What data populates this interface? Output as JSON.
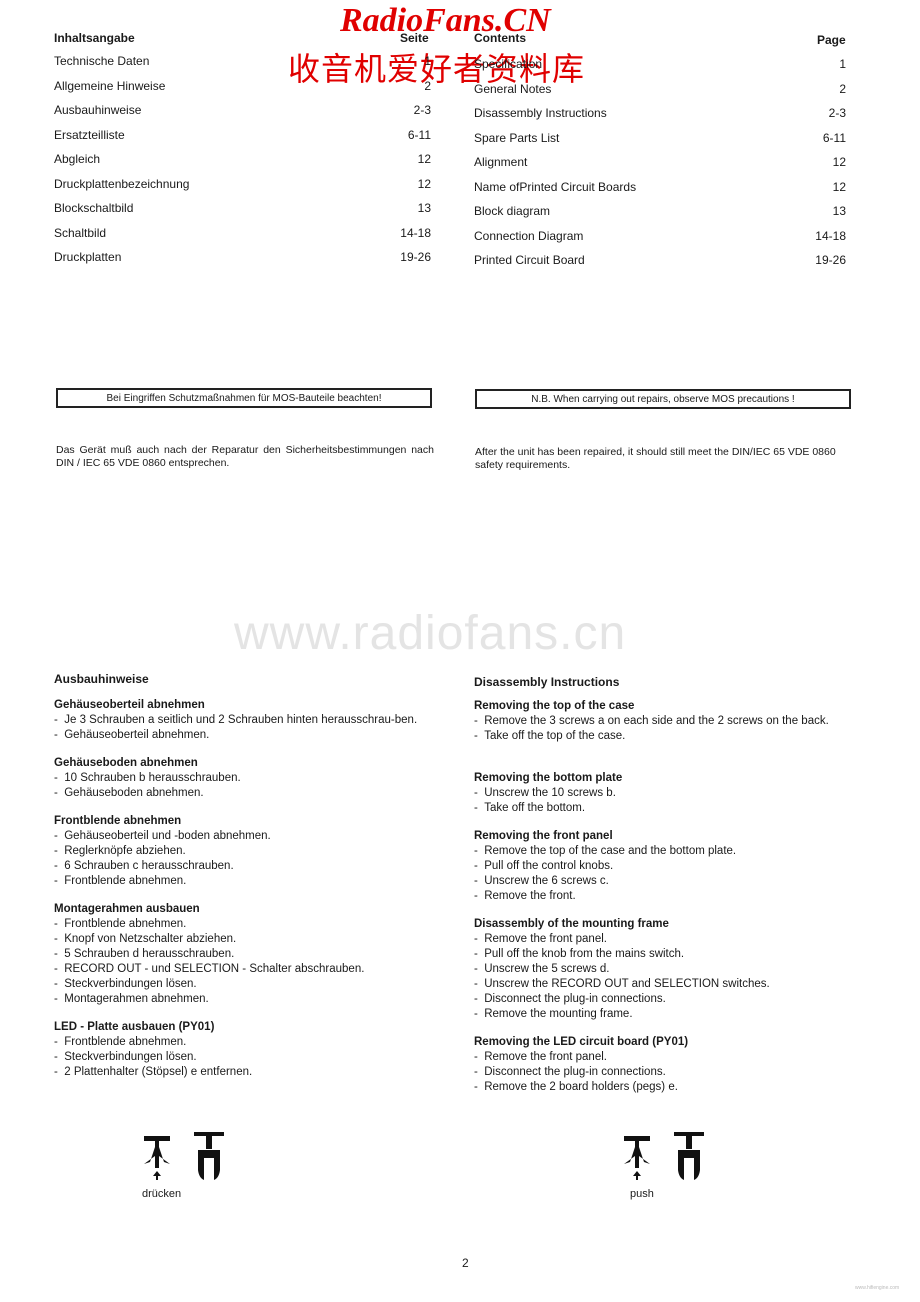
{
  "watermark": {
    "brand": "RadioFans.CN",
    "brand_cn": "收音机爱好者资料库",
    "url": "www.radiofans.cn",
    "color": "#e00000"
  },
  "toc_de": {
    "title": "Inhaltsangabe",
    "page_header": "Seite",
    "items": [
      {
        "label": "Technische Daten",
        "page": "1"
      },
      {
        "label": "Allgemeine Hinweise",
        "page": "2"
      },
      {
        "label": "Ausbauhinweise",
        "page": "2-3"
      },
      {
        "label": "Ersatzteilliste",
        "page": "6-11"
      },
      {
        "label": "Abgleich",
        "page": "12"
      },
      {
        "label": "Druckplattenbezeichnung",
        "page": "12"
      },
      {
        "label": "Blockschaltbild",
        "page": "13"
      },
      {
        "label": "Schaltbild",
        "page": "14-18"
      },
      {
        "label": "Druckplatten",
        "page": "19-26"
      }
    ]
  },
  "toc_en": {
    "title": "Contents",
    "page_header": "Page",
    "items": [
      {
        "label": "Specification",
        "page": "1"
      },
      {
        "label": "General Notes",
        "page": "2"
      },
      {
        "label": "Disassembly Instructions",
        "page": "2-3"
      },
      {
        "label": "Spare Parts List",
        "page": "6-11"
      },
      {
        "label": "Alignment",
        "page": "12"
      },
      {
        "label": "Name ofPrinted Circuit Boards",
        "page": "12"
      },
      {
        "label": "Block diagram",
        "page": "13"
      },
      {
        "label": "Connection Diagram",
        "page": "14-18"
      },
      {
        "label": "Printed Circuit Board",
        "page": "19-26"
      }
    ]
  },
  "notice_de": "Bei Eingriffen Schutzmaßnahmen für MOS-Bauteile beachten!",
  "notice_en": "N.B. When carrying out repairs, observe MOS precautions !",
  "safety_de": "Das Gerät muß auch nach der Reparatur den Sicherheitsbestimmungen nach  DIN / IEC 65 VDE 0860 entsprechen.",
  "safety_en": "After the unit has been repaired, it should still meet the DIN/IEC 65 VDE 0860 safety requirements.",
  "disassembly_de": {
    "title": "Ausbauhinweise",
    "sections": [
      {
        "heading": "Gehäuseoberteil abnehmen",
        "steps": [
          "Je 3 Schrauben a seitlich und 2 Schrauben hinten herausschrau-ben.",
          "Gehäuseoberteil abnehmen."
        ]
      },
      {
        "heading": "Gehäuseboden abnehmen",
        "steps": [
          "10 Schrauben b herausschrauben.",
          "Gehäuseboden abnehmen."
        ]
      },
      {
        "heading": "Frontblende abnehmen",
        "steps": [
          "Gehäuseoberteil und -boden abnehmen.",
          "Reglerknöpfe abziehen.",
          "6 Schrauben c herausschrauben.",
          "Frontblende abnehmen."
        ]
      },
      {
        "heading": "Montagerahmen ausbauen",
        "steps": [
          "Frontblende abnehmen.",
          "Knopf von Netzschalter abziehen.",
          "5 Schrauben d herausschrauben.",
          "RECORD OUT - und SELECTION - Schalter abschrauben.",
          "Steckverbindungen lösen.",
          "Montagerahmen abnehmen."
        ]
      },
      {
        "heading": "LED - Platte ausbauen (PY01)",
        "steps": [
          "Frontblende abnehmen.",
          "Steckverbindungen lösen.",
          "2 Plattenhalter (Stöpsel) e entfernen."
        ]
      }
    ],
    "figure_label": "drücken"
  },
  "disassembly_en": {
    "title": "Disassembly Instructions",
    "sections": [
      {
        "heading": "Removing the top of the case",
        "steps": [
          "Remove the 3 screws a on each side and the 2 screws on the back.",
          "Take off the top of the case."
        ]
      },
      {
        "heading": "Removing the bottom plate",
        "steps": [
          "Unscrew the 10 screws b.",
          "Take off the bottom."
        ]
      },
      {
        "heading": "Removing the front panel",
        "steps": [
          "Remove the top of the case and the bottom plate.",
          "Pull off the control knobs.",
          "Unscrew the 6 screws c.",
          "Remove the front."
        ]
      },
      {
        "heading": "Disassembly of the mounting frame",
        "steps": [
          "Remove the front panel.",
          "Pull off the knob from the mains switch.",
          "Unscrew the 5 screws d.",
          "Unscrew the RECORD OUT and SELECTION switches.",
          "Disconnect the plug-in connections.",
          "Remove the mounting frame."
        ]
      },
      {
        "heading": "Removing the LED circuit board (PY01)",
        "steps": [
          "Remove the front panel.",
          "Disconnect the plug-in connections.",
          "Remove the 2 board holders (pegs) e."
        ]
      }
    ],
    "figure_label": "push"
  },
  "page_number": "2",
  "footer_credit": "www.hifiengine.com"
}
